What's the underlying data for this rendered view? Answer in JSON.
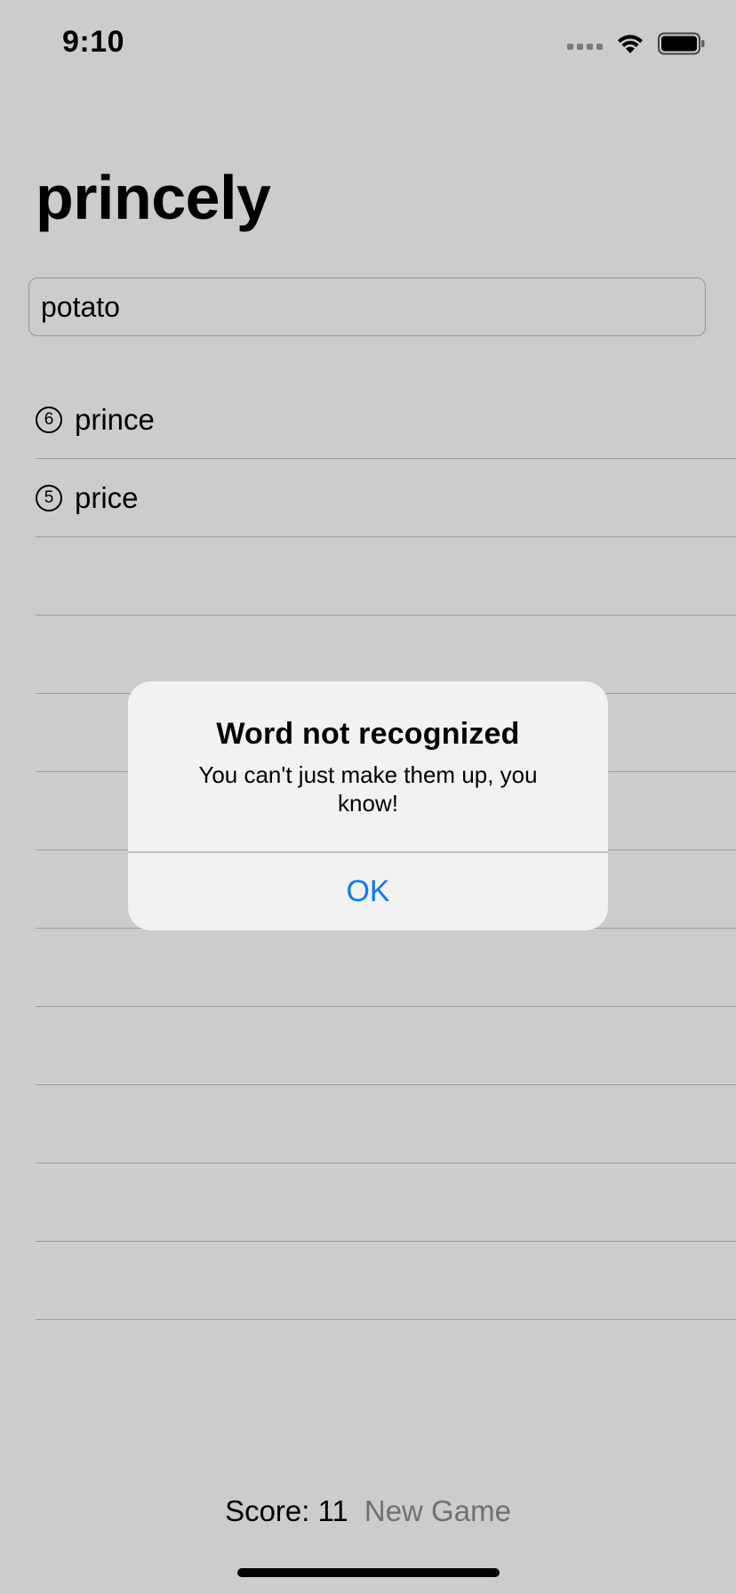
{
  "status_bar": {
    "time": "9:10"
  },
  "title": "princely",
  "input": {
    "value": "potato",
    "placeholder": ""
  },
  "words": [
    {
      "count": "6",
      "word": "prince"
    },
    {
      "count": "5",
      "word": "price"
    },
    {
      "count": "",
      "word": ""
    },
    {
      "count": "",
      "word": ""
    },
    {
      "count": "",
      "word": ""
    },
    {
      "count": "",
      "word": ""
    },
    {
      "count": "",
      "word": ""
    },
    {
      "count": "",
      "word": ""
    },
    {
      "count": "",
      "word": ""
    },
    {
      "count": "",
      "word": ""
    },
    {
      "count": "",
      "word": ""
    },
    {
      "count": "",
      "word": ""
    }
  ],
  "footer": {
    "score_label": "Score: 11",
    "new_game_label": "New Game"
  },
  "alert": {
    "title": "Word not recognized",
    "message": "You can't just make them up, you know!",
    "ok_label": "OK"
  },
  "colors": {
    "accent": "#0a7bf2",
    "overlay": "rgba(0,0,0,0.2)"
  }
}
